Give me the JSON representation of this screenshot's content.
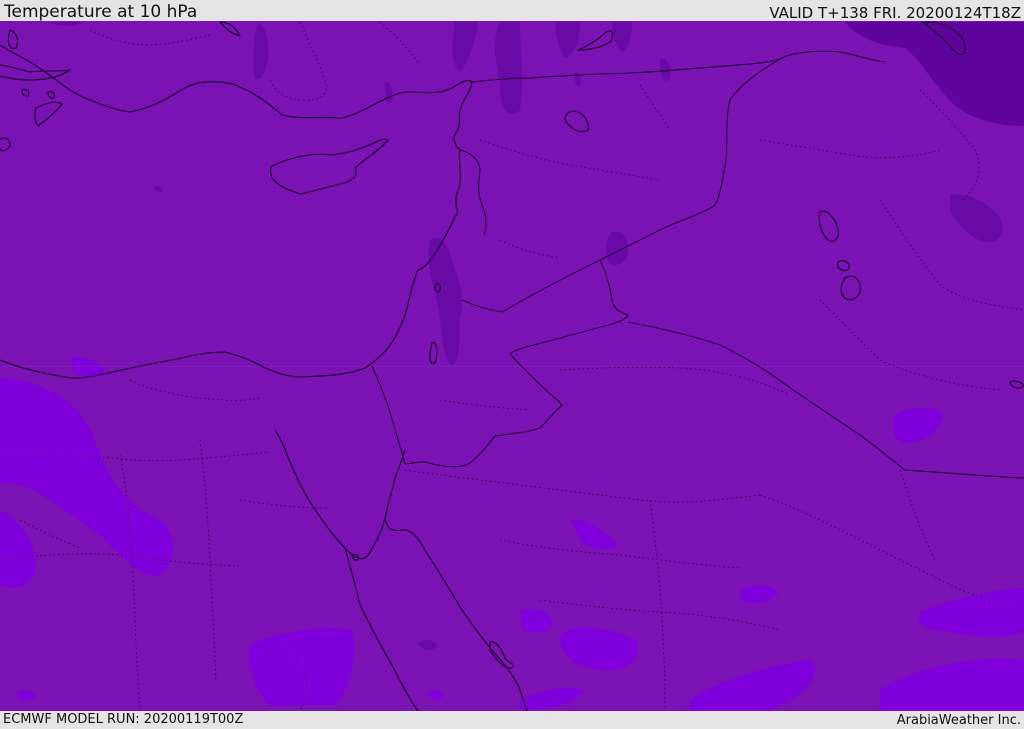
{
  "header": {
    "title": "Temperature at 10 hPa",
    "valid": "VALID T+138 FRI. 20200124T18Z"
  },
  "footer": {
    "model_run": "ECMWF MODEL RUN: 20200119T00Z",
    "credit": "ArabiaWeather Inc."
  },
  "map": {
    "colors": {
      "base": "#7a12b4",
      "warm": "#8000dc",
      "cold": "#6a0aa6",
      "coldest": "#5f049c",
      "coastline": "#1a0628",
      "border": "#1a0628"
    }
  }
}
